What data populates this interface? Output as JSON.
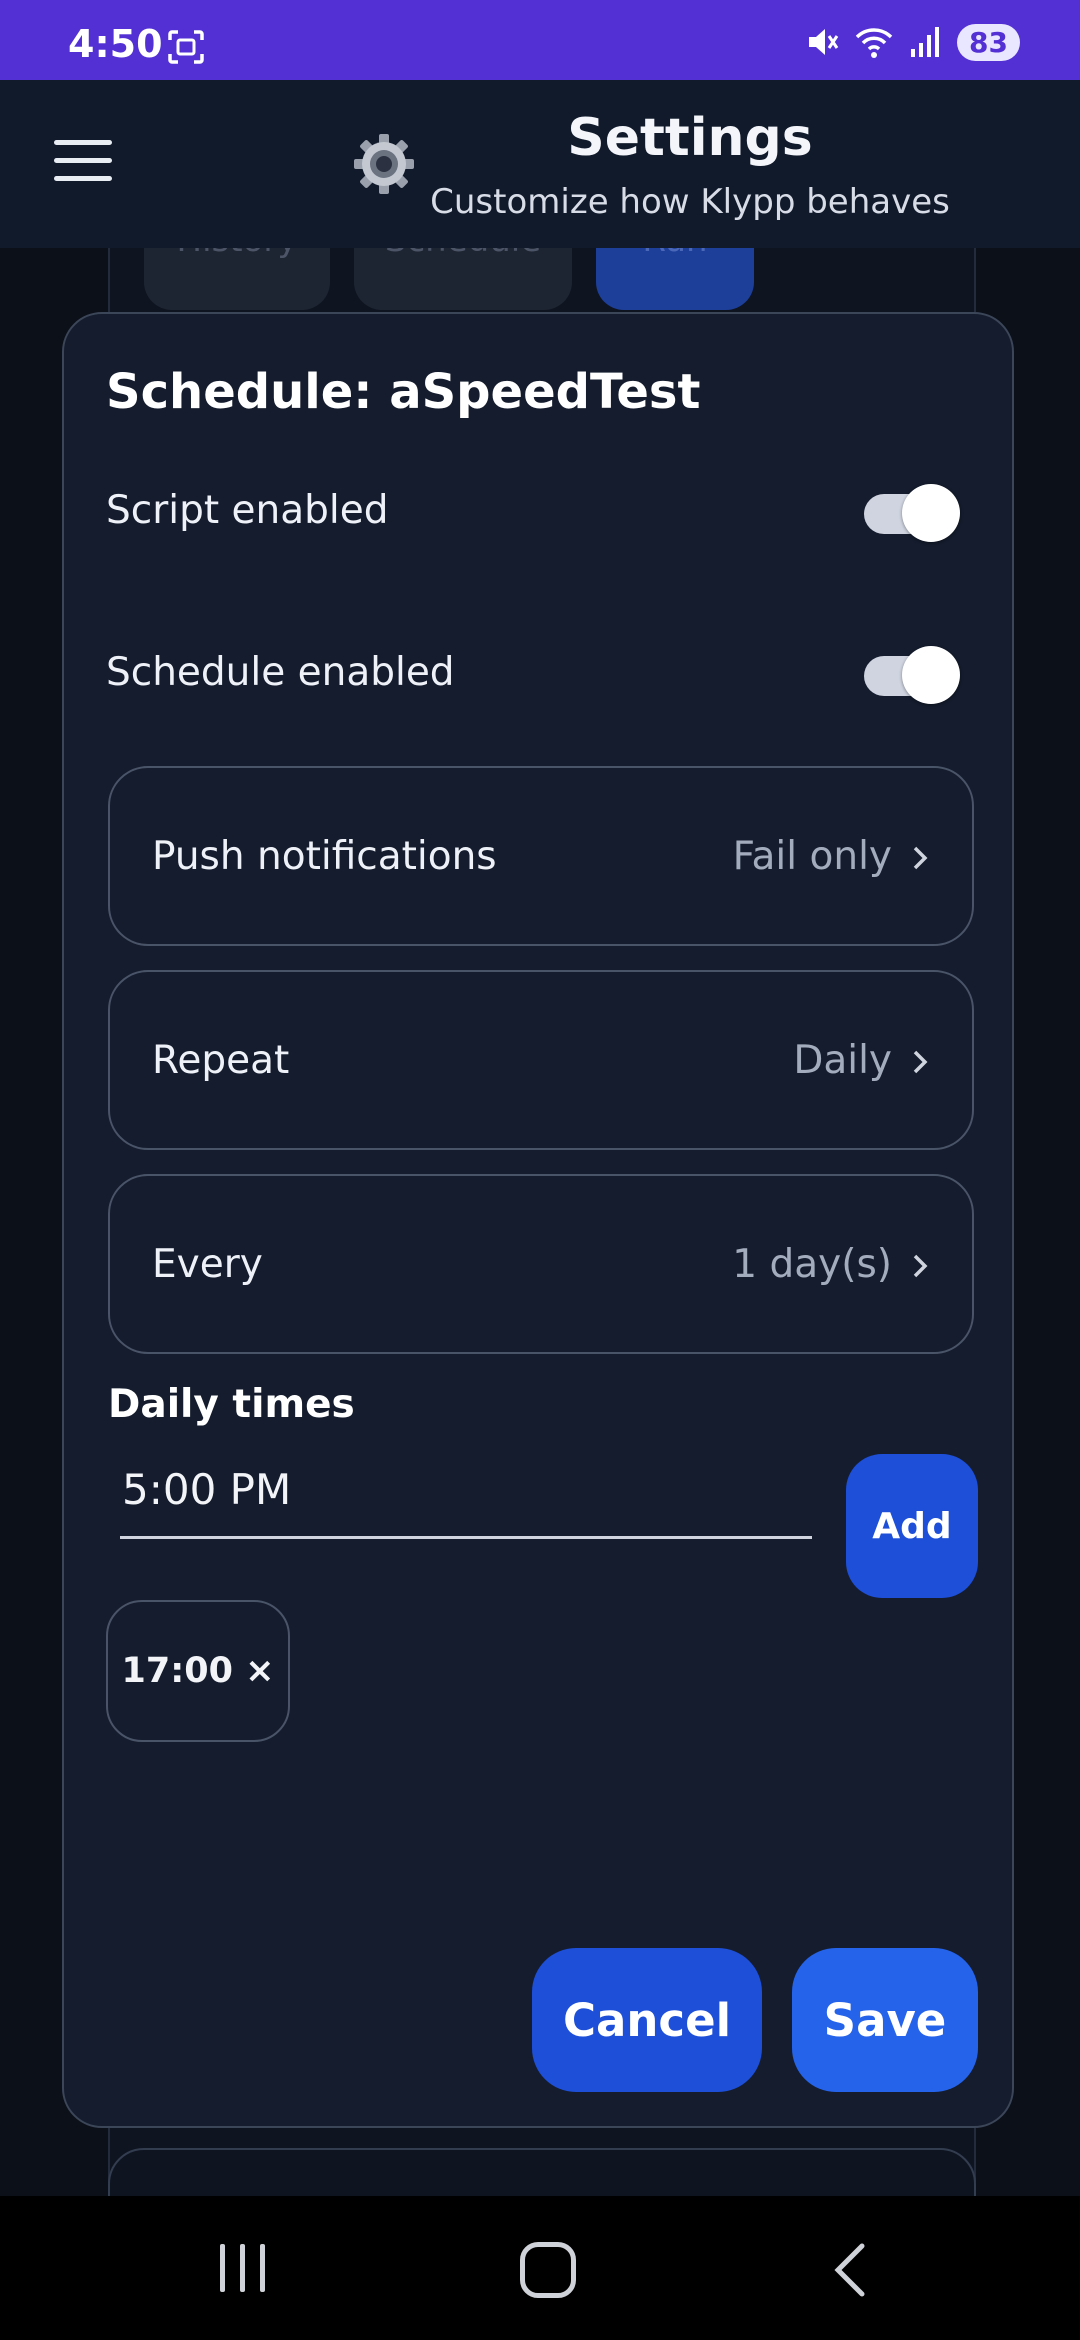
{
  "status_bar": {
    "time": "4:50",
    "battery": "83",
    "icons": [
      "screenshot-icon",
      "mute-icon",
      "wifi-icon",
      "signal-icon",
      "battery-icon"
    ]
  },
  "header": {
    "title": "Settings",
    "subtitle": "Customize how Klypp behaves",
    "icons": [
      "menu-icon",
      "gear-icon"
    ]
  },
  "background_tabs": [
    "History",
    "Schedule",
    "Run"
  ],
  "dialog": {
    "title": "Schedule: aSpeedTest",
    "script_enabled": {
      "label": "Script enabled",
      "on": true
    },
    "schedule_enabled": {
      "label": "Schedule enabled",
      "on": true
    },
    "rows": [
      {
        "label": "Push notifications",
        "value": "Fail only"
      },
      {
        "label": "Repeat",
        "value": "Daily"
      },
      {
        "label": "Every",
        "value": "1 day(s)"
      }
    ],
    "daily_times": {
      "label": "Daily times",
      "input_value": "5:00 PM",
      "add_label": "Add",
      "chips": [
        "17:00 ×"
      ]
    },
    "cancel_label": "Cancel",
    "save_label": "Save"
  },
  "colors": {
    "status_bar": "#5230d4",
    "header": "#111a2a",
    "dialog": "#141c2d",
    "primary_button": "#1d4fd8",
    "save_button": "#2563eb"
  }
}
